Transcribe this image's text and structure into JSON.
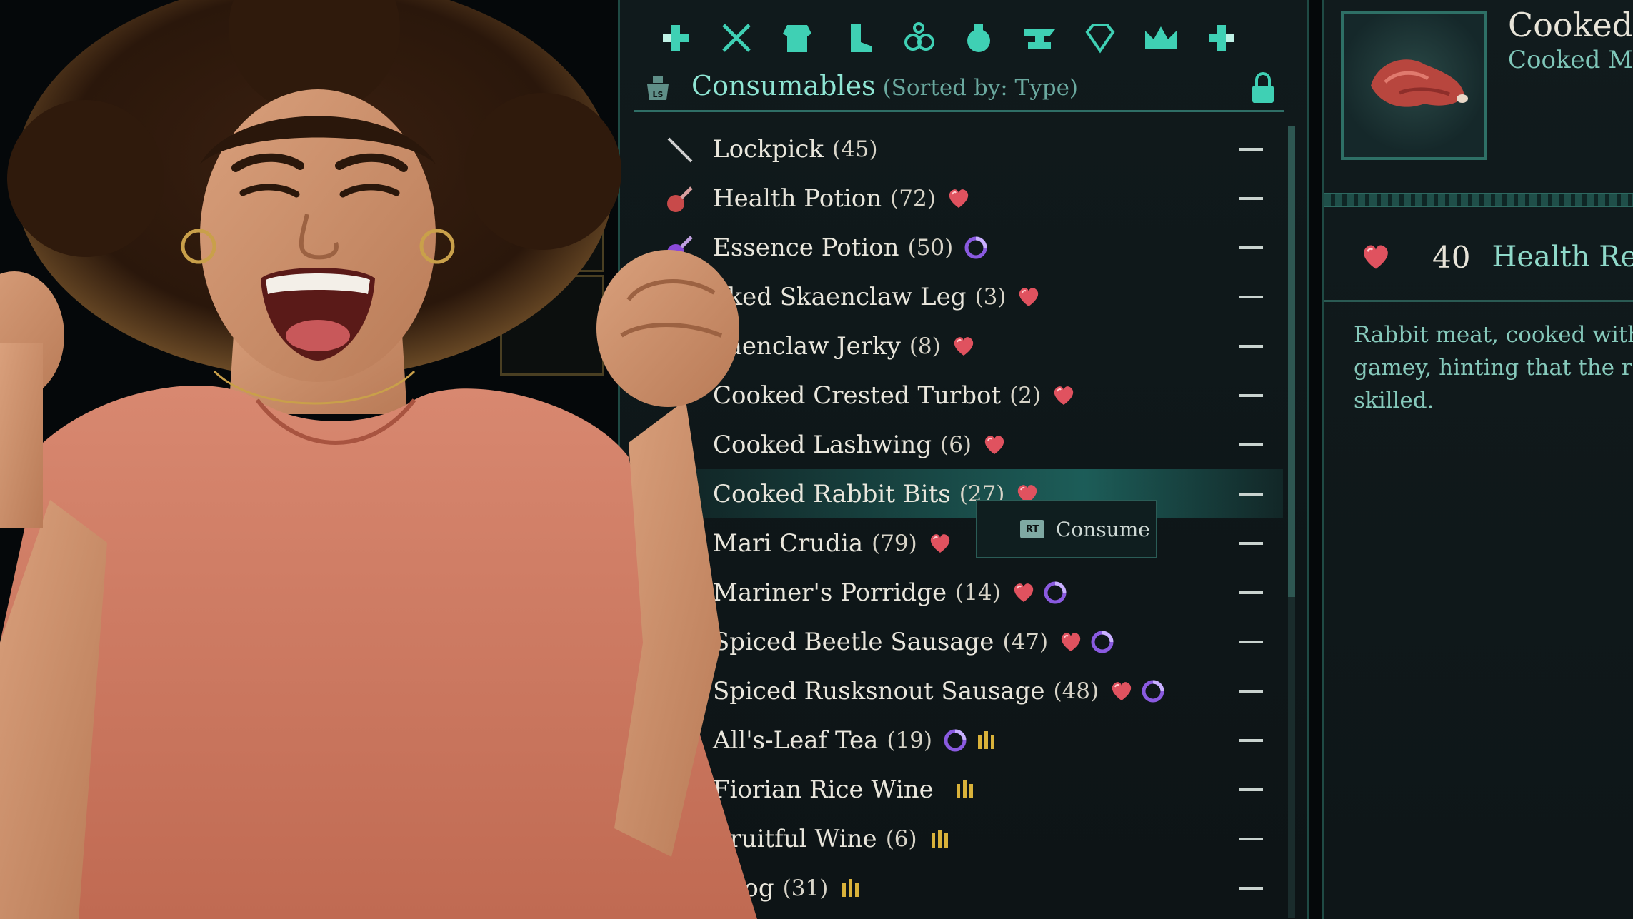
{
  "inventory": {
    "tabs": [
      "dpad-left-icon",
      "crossed-swords-icon",
      "armor-icon",
      "boot-icon",
      "rings-icon",
      "potion-bag-icon",
      "anvil-icon",
      "gem-icon",
      "crown-icon",
      "dpad-right-icon"
    ],
    "section_title": "Consumables",
    "sort_label": "(Sorted by: Type)",
    "items": [
      {
        "name": "Lockpick",
        "count": "(45)",
        "icon": "lockpick-icon",
        "effects": []
      },
      {
        "name": "Health Potion",
        "count": "(72)",
        "icon": "health-potion-icon",
        "effects": [
          "heart"
        ]
      },
      {
        "name": "Essence Potion",
        "count": "(50)",
        "icon": "essence-potion-icon",
        "effects": [
          "essence"
        ]
      },
      {
        "name": "oked Skaenclaw Leg",
        "count": "(3)",
        "icon": "food-icon",
        "effects": [
          "heart"
        ]
      },
      {
        "name": "kaenclaw Jerky",
        "count": "(8)",
        "icon": "food-icon",
        "effects": [
          "heart"
        ]
      },
      {
        "name": "Cooked Crested Turbot",
        "count": "(2)",
        "icon": "food-icon",
        "effects": [
          "heart"
        ]
      },
      {
        "name": "Cooked Lashwing",
        "count": "(6)",
        "icon": "food-icon",
        "effects": [
          "heart"
        ]
      },
      {
        "name": "Cooked Rabbit Bits",
        "count": "(27)",
        "icon": "food-icon",
        "effects": [
          "heart"
        ],
        "selected": true
      },
      {
        "name": "Mari Crudia",
        "count": "(79)",
        "icon": "food-icon",
        "effects": [
          "heart"
        ]
      },
      {
        "name": "Mariner's Porridge",
        "count": "(14)",
        "icon": "food-icon",
        "effects": [
          "heart",
          "essence"
        ]
      },
      {
        "name": "Spiced Beetle Sausage",
        "count": "(47)",
        "icon": "food-icon",
        "effects": [
          "heart",
          "essence"
        ]
      },
      {
        "name": "Spiced Rusksnout Sausage",
        "count": "(48)",
        "icon": "food-icon",
        "effects": [
          "heart",
          "essence"
        ]
      },
      {
        "name": "All's-Leaf Tea",
        "count": "(19)",
        "icon": "drink-icon",
        "effects": [
          "essence",
          "stamina"
        ]
      },
      {
        "name": "Fiorian Rice Wine",
        "count": "",
        "icon": "drink-icon",
        "effects": [
          "stamina"
        ]
      },
      {
        "name": "Fruitful Wine",
        "count": "(6)",
        "icon": "drink-icon",
        "effects": [
          "stamina"
        ]
      },
      {
        "name": "Grog",
        "count": "(31)",
        "icon": "grog-icon",
        "effects": [
          "stamina"
        ]
      }
    ],
    "consume_key": "RT",
    "consume_label": "Consume"
  },
  "details": {
    "title": "Cooked",
    "subtitle": "Cooked Me",
    "stat_value": "40",
    "stat_label": "Health Re",
    "description": [
      "Rabbit meat, cooked with",
      "gamey, hinting that the ra",
      "skilled."
    ]
  },
  "colors": {
    "accent": "#8fe6d4",
    "heart": "#e0525f",
    "essence": "#8a5ae0",
    "stamina": "#d9b23a"
  }
}
